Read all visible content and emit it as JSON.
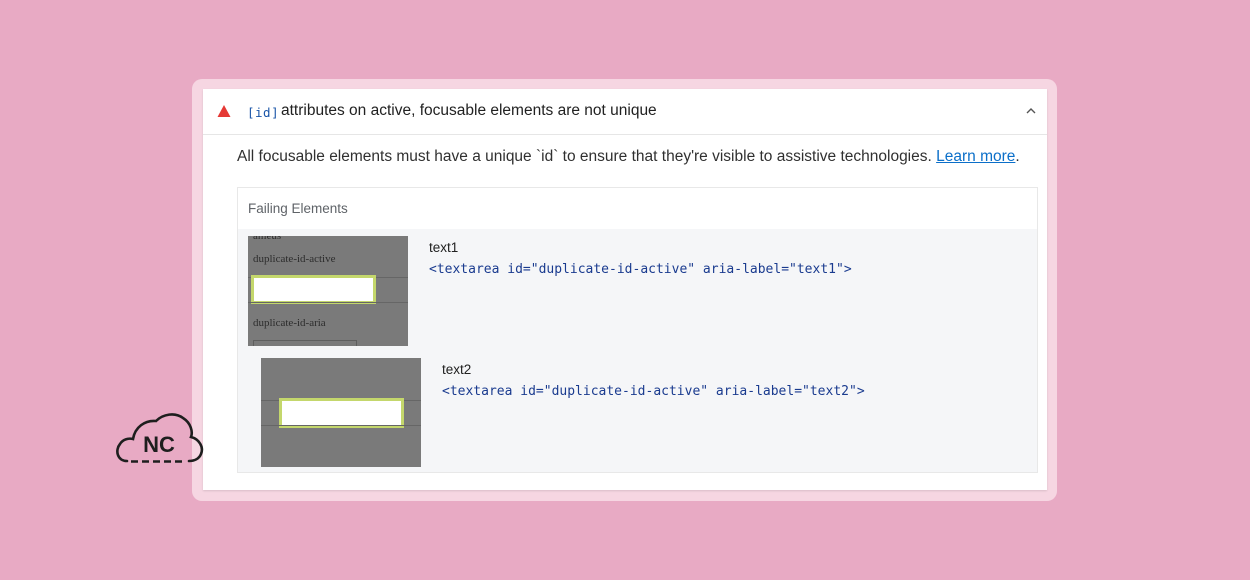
{
  "audit": {
    "title_code": "[id]",
    "title_text": "attributes on active, focusable elements are not unique",
    "description": "All focusable elements must have a unique `id` to ensure that they're visible to assistive technologies.",
    "learn_more": "Learn more",
    "period": "."
  },
  "table": {
    "header": "Failing Elements",
    "rows": [
      {
        "label": "text1",
        "snippet": "<textarea id=\"duplicate-id-active\" aria-label=\"text1\">",
        "thumb_texts": [
          "ameus",
          "duplicate-id-active",
          "duplicate-id-aria"
        ]
      },
      {
        "label": "text2",
        "snippet": "<textarea id=\"duplicate-id-active\" aria-label=\"text2\">"
      }
    ]
  },
  "logo": {
    "text": "NC"
  },
  "colors": {
    "background": "#e8aac4",
    "warning": "#e53935",
    "link": "#0b6fc9",
    "code": "#1a3b8f",
    "highlight": "#c4d76c"
  },
  "icons": [
    "warning-triangle-icon",
    "chevron-up-icon",
    "cloud-logo-icon"
  ]
}
